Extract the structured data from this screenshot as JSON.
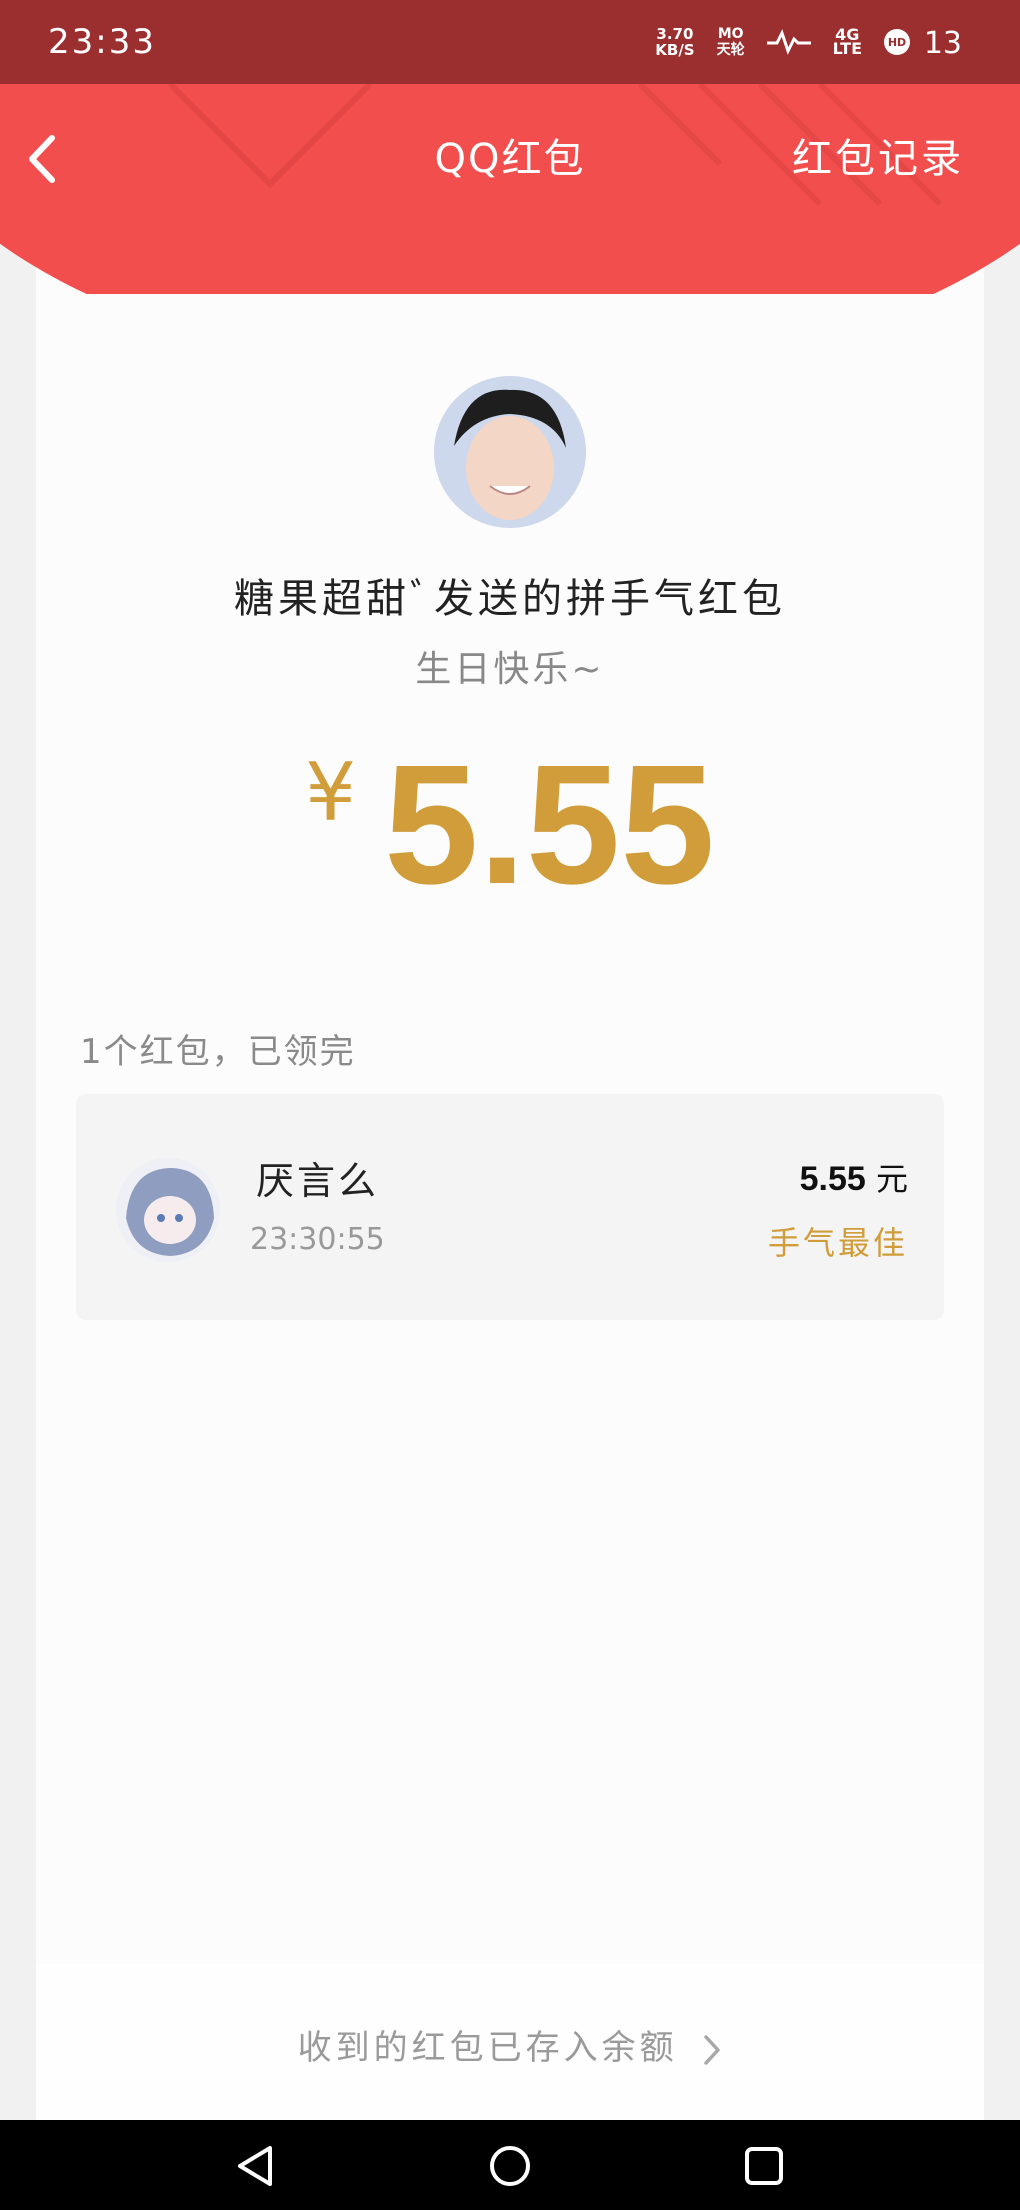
{
  "status": {
    "time": "23:33",
    "net_speed_value": "3.70",
    "net_speed_unit": "KB/S",
    "carrier_top": "MO",
    "carrier_bottom": "天轮",
    "network_top": "4G",
    "network_bottom": "LTE",
    "hd": "HD",
    "battery": "13"
  },
  "header": {
    "title": "QQ红包",
    "record_link": "红包记录"
  },
  "envelope": {
    "sender_line": "糖果超甜ﾞ发送的拼手气红包",
    "greeting": "生日快乐~",
    "currency": "¥",
    "amount": "5.55"
  },
  "summary": "1个红包，已领完",
  "records": [
    {
      "name": "厌言么",
      "time": "23:30:55",
      "amount": "5.55",
      "unit": "元",
      "badge": "手气最佳"
    }
  ],
  "footer_link": "收到的红包已存入余额",
  "colors": {
    "header_red": "#f24e4e",
    "status_bar": "#9b2f2f",
    "gold": "#d19d3a"
  },
  "icons": [
    "back-icon",
    "chevron-right-icon",
    "nav-back-icon",
    "nav-home-icon",
    "nav-recents-icon"
  ]
}
